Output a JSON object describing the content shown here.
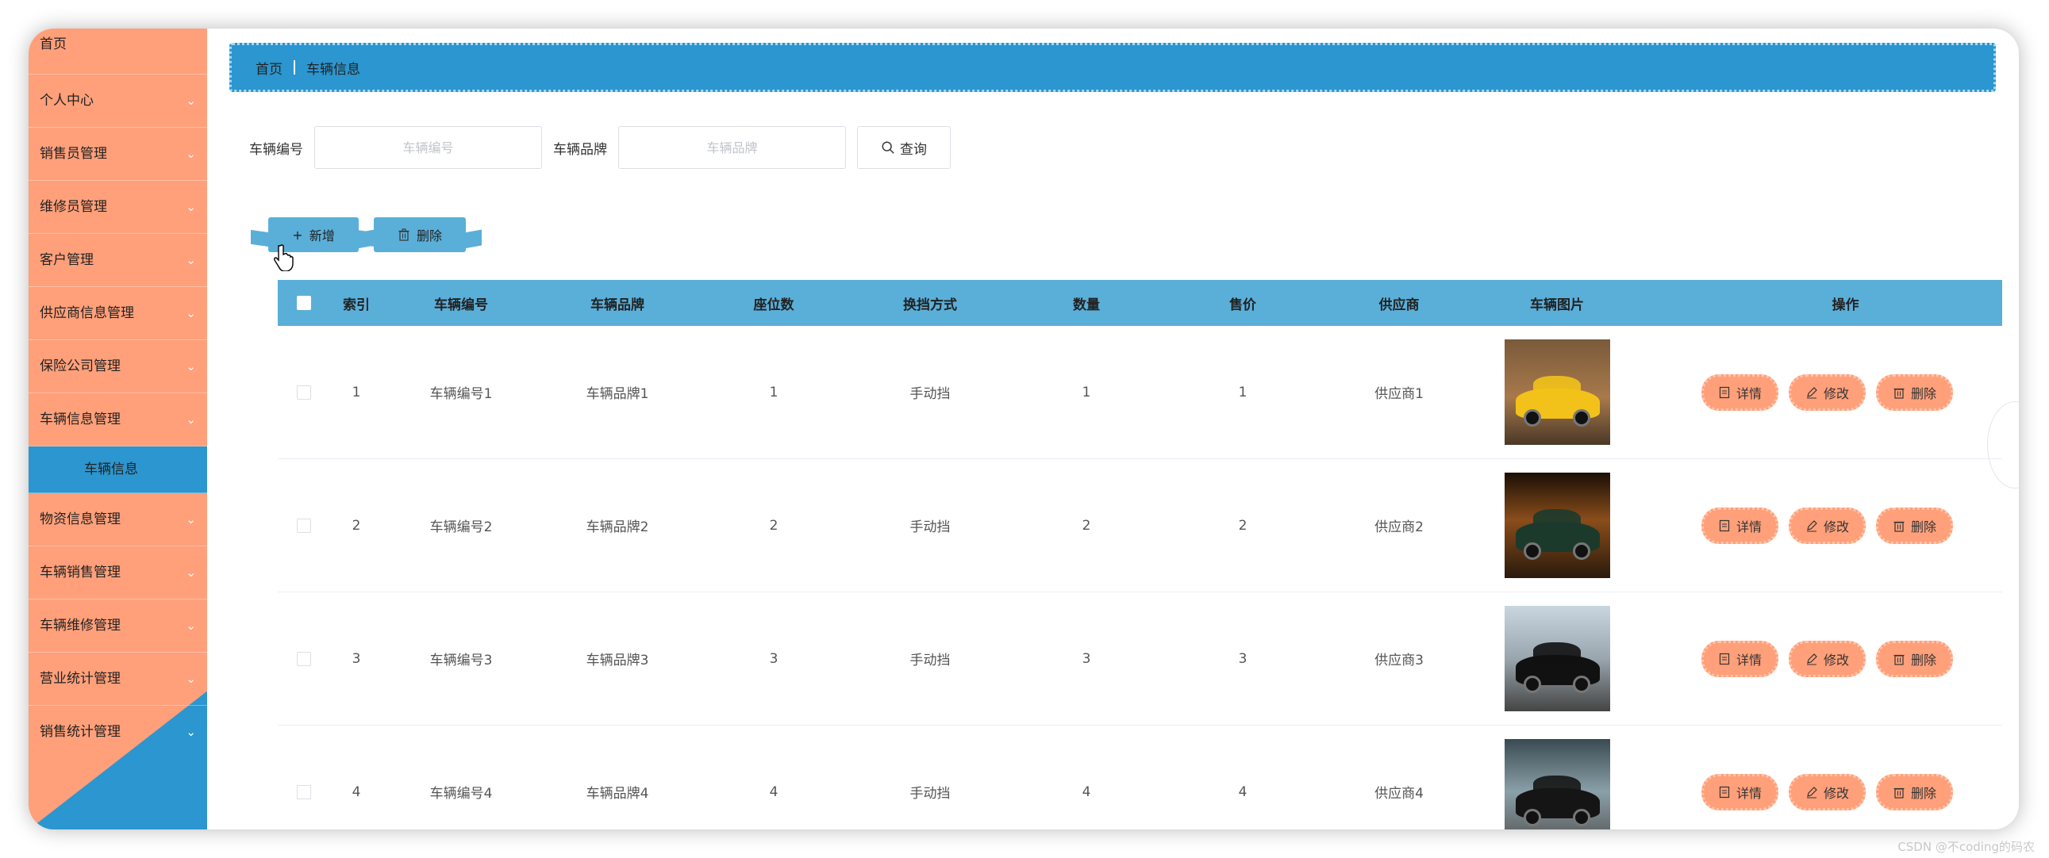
{
  "sidebar": {
    "items": [
      {
        "label": "首页",
        "chevron": false
      },
      {
        "label": "个人中心",
        "chevron": true
      },
      {
        "label": "销售员管理",
        "chevron": true
      },
      {
        "label": "维修员管理",
        "chevron": true
      },
      {
        "label": "客户管理",
        "chevron": true
      },
      {
        "label": "供应商信息管理",
        "chevron": true
      },
      {
        "label": "保险公司管理",
        "chevron": true
      },
      {
        "label": "车辆信息管理",
        "chevron": true
      },
      {
        "label": "车辆信息",
        "chevron": false,
        "sub": true,
        "active": true
      },
      {
        "label": "物资信息管理",
        "chevron": true
      },
      {
        "label": "车辆销售管理",
        "chevron": true
      },
      {
        "label": "车辆维修管理",
        "chevron": true
      },
      {
        "label": "营业统计管理",
        "chevron": true
      },
      {
        "label": "销售统计管理",
        "chevron": true
      }
    ],
    "chevron_glyph": "⌄"
  },
  "breadcrumb": {
    "home": "首页",
    "current": "车辆信息"
  },
  "search": {
    "code_label": "车辆编号",
    "code_placeholder": "车辆编号",
    "brand_label": "车辆品牌",
    "brand_placeholder": "车辆品牌",
    "button_label": "查询"
  },
  "actions": {
    "add_label": "新增",
    "delete_label": "删除"
  },
  "table": {
    "headers": [
      "索引",
      "车辆编号",
      "车辆品牌",
      "座位数",
      "换挡方式",
      "数量",
      "售价",
      "供应商",
      "车辆图片",
      "操作"
    ],
    "rows": [
      {
        "index": "1",
        "code": "车辆编号1",
        "brand": "车辆品牌1",
        "seats": "1",
        "gear": "手动挡",
        "qty": "1",
        "price": "1",
        "supplier": "供应商1"
      },
      {
        "index": "2",
        "code": "车辆编号2",
        "brand": "车辆品牌2",
        "seats": "2",
        "gear": "手动挡",
        "qty": "2",
        "price": "2",
        "supplier": "供应商2"
      },
      {
        "index": "3",
        "code": "车辆编号3",
        "brand": "车辆品牌3",
        "seats": "3",
        "gear": "手动挡",
        "qty": "3",
        "price": "3",
        "supplier": "供应商3"
      },
      {
        "index": "4",
        "code": "车辆编号4",
        "brand": "车辆品牌4",
        "seats": "4",
        "gear": "手动挡",
        "qty": "4",
        "price": "4",
        "supplier": "供应商4"
      }
    ],
    "ops": {
      "detail": "详情",
      "edit": "修改",
      "delete": "删除"
    }
  },
  "watermark": "CSDN @不coding的码农",
  "colors": {
    "sidebar": "#ffa07a",
    "accent_blue": "#2b96cf",
    "table_header": "#5aafd9",
    "op_button": "#ffa07a"
  }
}
